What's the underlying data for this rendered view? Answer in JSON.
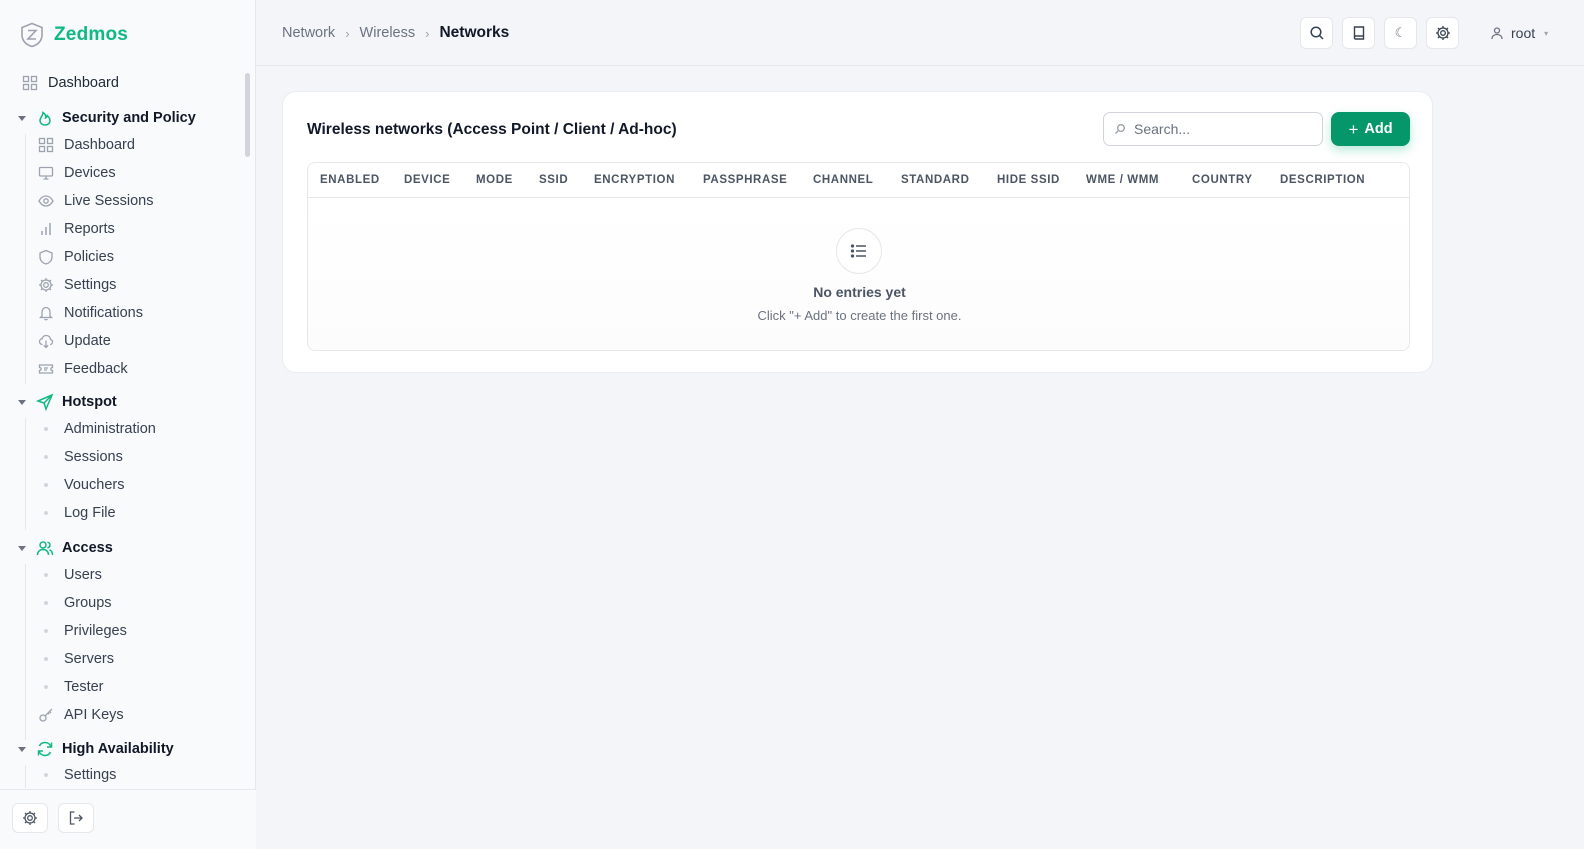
{
  "app": {
    "name": "Zedmos",
    "brand_color": "#10b981"
  },
  "sidebar": {
    "top_item": {
      "label": "Dashboard",
      "icon": "grid-icon"
    },
    "groups": [
      {
        "label": "Security and Policy",
        "icon": "flame-icon",
        "items": [
          {
            "label": "Dashboard",
            "icon": "grid-icon"
          },
          {
            "label": "Devices",
            "icon": "monitor-icon"
          },
          {
            "label": "Live Sessions",
            "icon": "eye-icon"
          },
          {
            "label": "Reports",
            "icon": "bar-chart-icon"
          },
          {
            "label": "Policies",
            "icon": "shield-icon"
          },
          {
            "label": "Settings",
            "icon": "gear-icon"
          },
          {
            "label": "Notifications",
            "icon": "bell-icon"
          },
          {
            "label": "Update",
            "icon": "cloud-download-icon"
          },
          {
            "label": "Feedback",
            "icon": "ticket-icon"
          }
        ]
      },
      {
        "label": "Hotspot",
        "icon": "send-icon",
        "items": [
          {
            "label": "Administration"
          },
          {
            "label": "Sessions"
          },
          {
            "label": "Vouchers"
          },
          {
            "label": "Log File"
          }
        ]
      },
      {
        "label": "Access",
        "icon": "users-icon",
        "items": [
          {
            "label": "Users"
          },
          {
            "label": "Groups"
          },
          {
            "label": "Privileges"
          },
          {
            "label": "Servers"
          },
          {
            "label": "Tester"
          },
          {
            "label": "API Keys",
            "icon": "key-icon"
          }
        ]
      },
      {
        "label": "High Availability",
        "icon": "refresh-icon",
        "items": [
          {
            "label": "Settings"
          }
        ]
      }
    ],
    "footer": {
      "settings_icon": "gear-icon",
      "logout_icon": "logout-icon"
    }
  },
  "header": {
    "breadcrumb": [
      "Network",
      "Wireless",
      "Networks"
    ],
    "toolbar_icons": [
      "search-icon",
      "book-icon",
      "moon-icon",
      "gear-icon"
    ],
    "user": "root"
  },
  "card": {
    "title": "Wireless networks (Access Point / Client / Ad-hoc)",
    "search_placeholder": "Search...",
    "add_label": "Add",
    "columns": [
      "ENABLED",
      "DEVICE",
      "MODE",
      "SSID",
      "ENCRYPTION",
      "PASSPHRASE",
      "CHANNEL",
      "STANDARD",
      "HIDE SSID",
      "WME / WMM",
      "COUNTRY",
      "DESCRIPTION"
    ],
    "empty_title": "No entries yet",
    "empty_subtitle": "Click \"+ Add\" to create the first one."
  }
}
